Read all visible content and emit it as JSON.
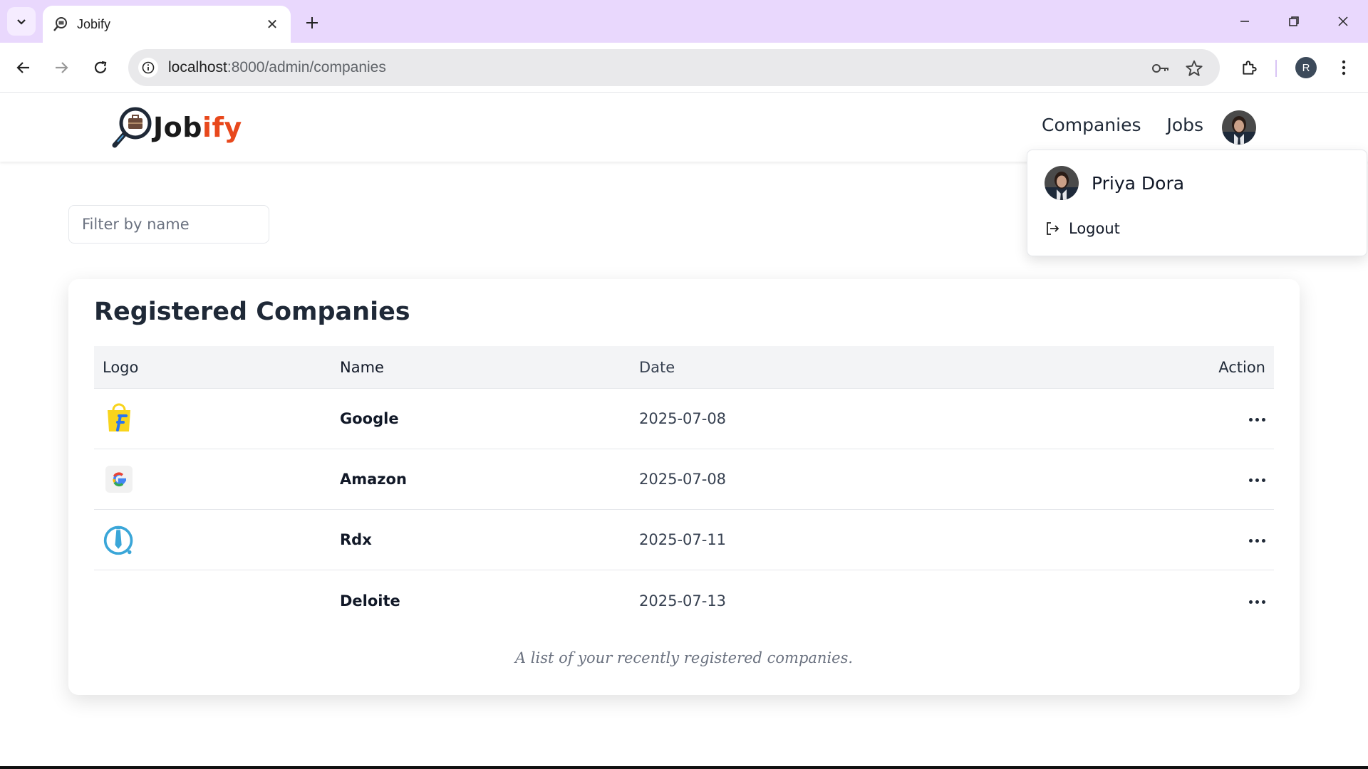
{
  "browser": {
    "tab_title": "Jobify",
    "url_host": "localhost",
    "url_path": ":8000/admin/companies",
    "profile_initial": "R"
  },
  "navbar": {
    "logo_text_dark": "Job",
    "logo_text_accent": "ify",
    "links": [
      "Companies",
      "Jobs"
    ]
  },
  "filter": {
    "placeholder": "Filter by name",
    "value": ""
  },
  "card": {
    "title": "Registered Companies",
    "columns": [
      "Logo",
      "Name",
      "Date",
      "Action"
    ],
    "rows": [
      {
        "logo": "flipkart-logo",
        "name": "Google",
        "date": "2025-07-08"
      },
      {
        "logo": "google-logo",
        "name": "Amazon",
        "date": "2025-07-08"
      },
      {
        "logo": "rdx-logo",
        "name": "Rdx",
        "date": "2025-07-11"
      },
      {
        "logo": "",
        "name": "Deloite",
        "date": "2025-07-13"
      }
    ],
    "caption": "A list of your recently registered companies."
  },
  "dropdown": {
    "user_name": "Priya Dora",
    "logout_label": "Logout"
  },
  "colors": {
    "tabstrip": "#e9d8fd",
    "logo_accent": "#e8481c",
    "table_header": "#f3f4f6"
  }
}
